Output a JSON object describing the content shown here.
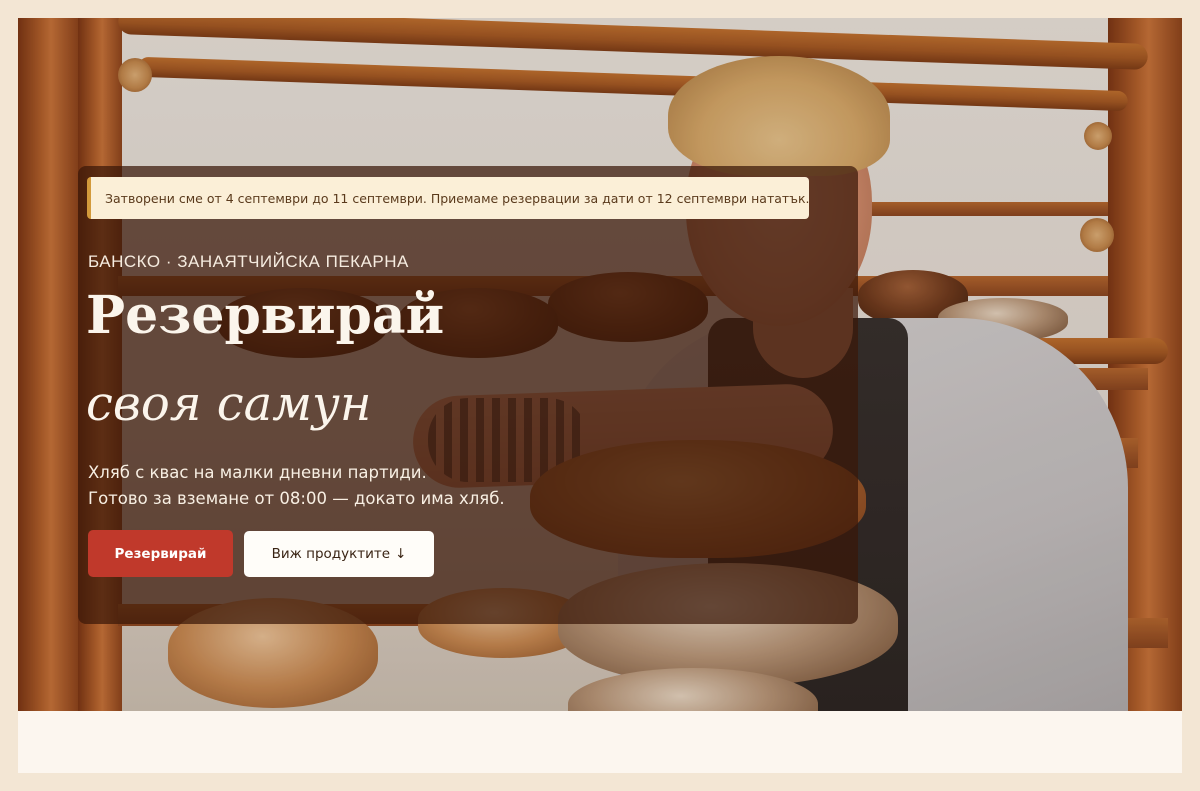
{
  "notice": {
    "text": "Затворени сме от 4 септември до 11 септември. Приемаме резервации за дати от 12 септември нататък."
  },
  "hero": {
    "eyebrow": "БАНСКО · ЗАНАЯТЧИЙСКА ПЕКАРНА",
    "title_line1": "Резервирай",
    "title_line2": "своя самун",
    "subtitle_line1": "Хляб с квас на малки дневни партиди.",
    "subtitle_line2": "Готово за вземане от 08:00 — докато има хляб."
  },
  "buttons": {
    "reserve_label": "Резервирай",
    "products_label": "Виж продуктите",
    "products_icon": "↓"
  },
  "colors": {
    "accent": "#c0392b",
    "notice_bg": "#fbefd7",
    "notice_border": "#d39a3b",
    "page_bg": "#f3e6d4"
  },
  "icons": {
    "products_arrow": "arrow-down-icon"
  }
}
